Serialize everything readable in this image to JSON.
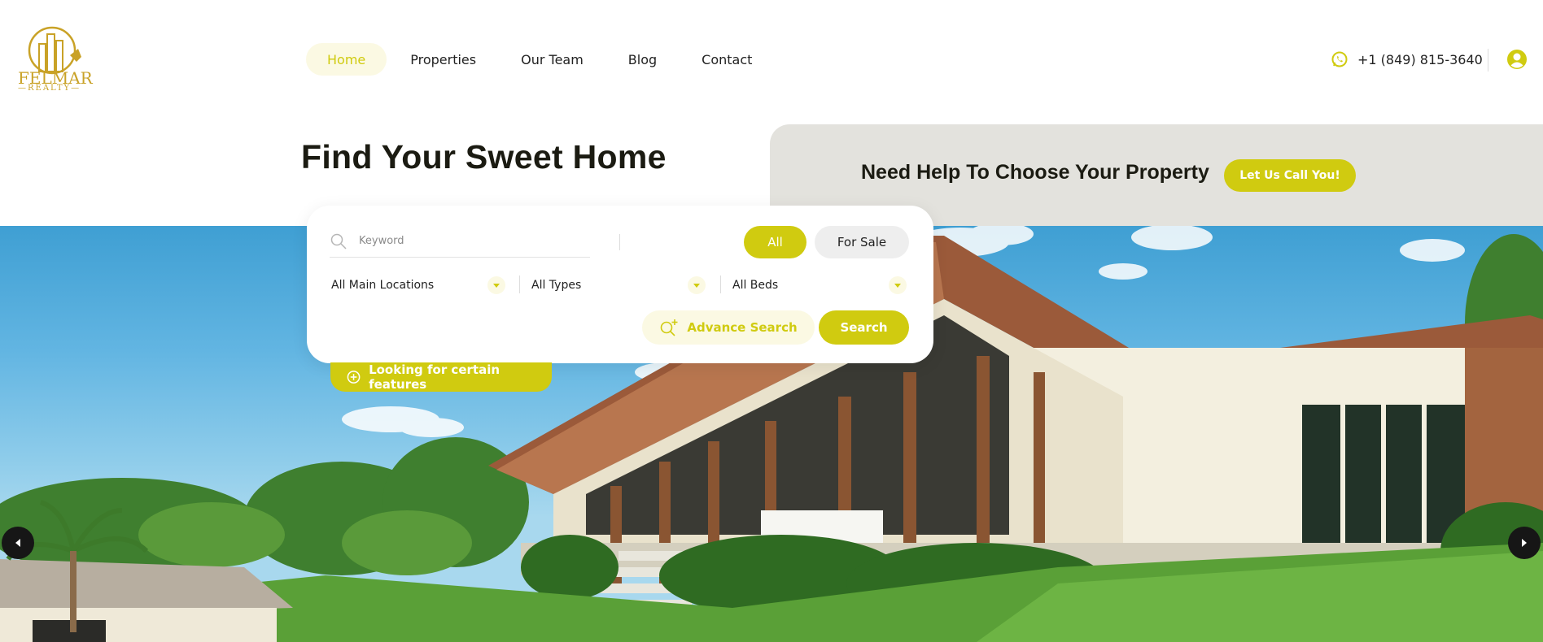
{
  "brand": {
    "name": "FELMAR",
    "sub": "REALTY",
    "logo_icon": "building-logo-icon",
    "color": "#c9a227"
  },
  "nav": {
    "items": [
      {
        "label": "Home",
        "active": true
      },
      {
        "label": "Properties",
        "active": false
      },
      {
        "label": "Our Team",
        "active": false
      },
      {
        "label": "Blog",
        "active": false
      },
      {
        "label": "Contact",
        "active": false
      }
    ]
  },
  "contact": {
    "phone": "+1 (849) 815-3640",
    "phone_icon": "whatsapp-icon"
  },
  "account": {
    "icon": "user-circle-icon"
  },
  "hero": {
    "title": "Find Your Sweet Home"
  },
  "help": {
    "text": "Need Help To Choose Your Property",
    "button_label": "Let Us Call You!"
  },
  "search": {
    "keyword_placeholder": "Keyword",
    "keyword_value": "",
    "status_tabs": [
      {
        "label": "All",
        "active": true
      },
      {
        "label": "For Sale",
        "active": false
      }
    ],
    "selects": [
      {
        "label": "All Main Locations"
      },
      {
        "label": "All Types"
      },
      {
        "label": "All Beds"
      }
    ],
    "advance_label": "Advance Search",
    "search_label": "Search",
    "features_label": "Looking for certain features"
  },
  "colors": {
    "accent": "#d0cb10",
    "accent_light": "#fbf9e3",
    "panel": "#e3e2dd",
    "text": "#1b1b12"
  }
}
